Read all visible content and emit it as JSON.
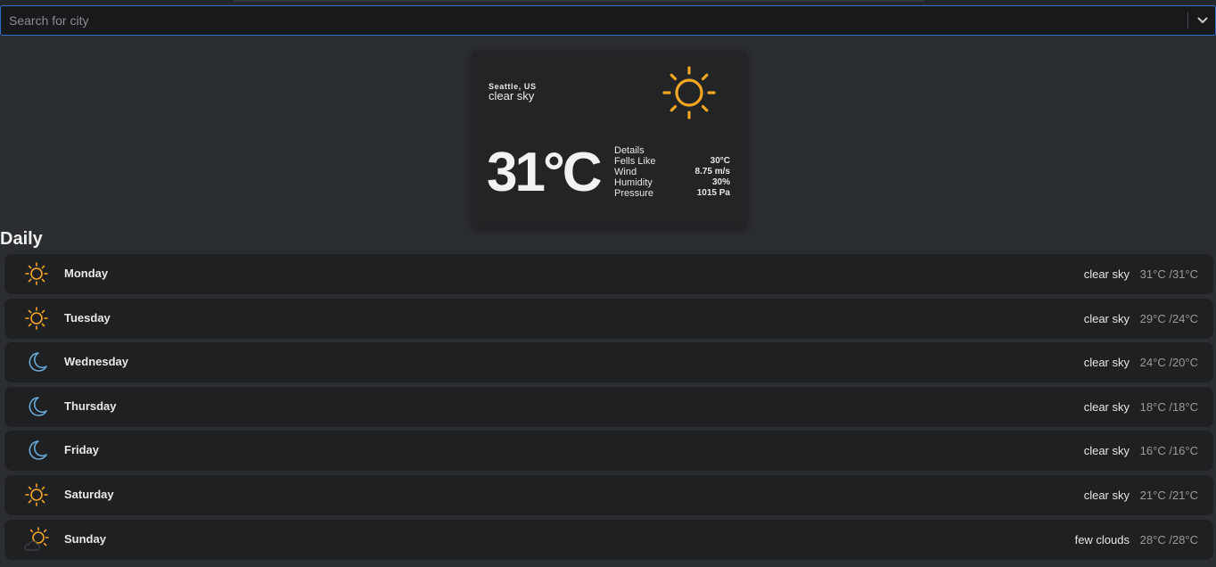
{
  "colors": {
    "background": "#2b2e31",
    "card": "#222426",
    "row": "#1e2022",
    "sun": "#f5a623",
    "moon": "#6aa9d8",
    "focus_border": "#2f6fd4"
  },
  "search": {
    "placeholder": "Search for city",
    "value": "",
    "dropdown_icon": "chevron-down-icon"
  },
  "current": {
    "city": "Seattle, US",
    "description": "clear sky",
    "icon": "sun-icon",
    "temperature": "31°C",
    "details_label": "Details",
    "details": [
      {
        "label": "Fells Like",
        "value": "30°C"
      },
      {
        "label": "Wind",
        "value": "8.75 m/s"
      },
      {
        "label": "Humidity",
        "value": "30%"
      },
      {
        "label": "Pressure",
        "value": "1015 Pa"
      }
    ]
  },
  "daily": {
    "title": "Daily",
    "days": [
      {
        "name": "Monday",
        "icon": "sun-icon",
        "description": "clear sky",
        "temps": "31°C /31°C"
      },
      {
        "name": "Tuesday",
        "icon": "sun-icon",
        "description": "clear sky",
        "temps": "29°C /24°C"
      },
      {
        "name": "Wednesday",
        "icon": "moon-icon",
        "description": "clear sky",
        "temps": "24°C /20°C"
      },
      {
        "name": "Thursday",
        "icon": "moon-icon",
        "description": "clear sky",
        "temps": "18°C /18°C"
      },
      {
        "name": "Friday",
        "icon": "moon-icon",
        "description": "clear sky",
        "temps": "16°C /16°C"
      },
      {
        "name": "Saturday",
        "icon": "sun-icon",
        "description": "clear sky",
        "temps": "21°C /21°C"
      },
      {
        "name": "Sunday",
        "icon": "sun-cloud-icon",
        "description": "few clouds",
        "temps": "28°C /28°C"
      }
    ]
  }
}
